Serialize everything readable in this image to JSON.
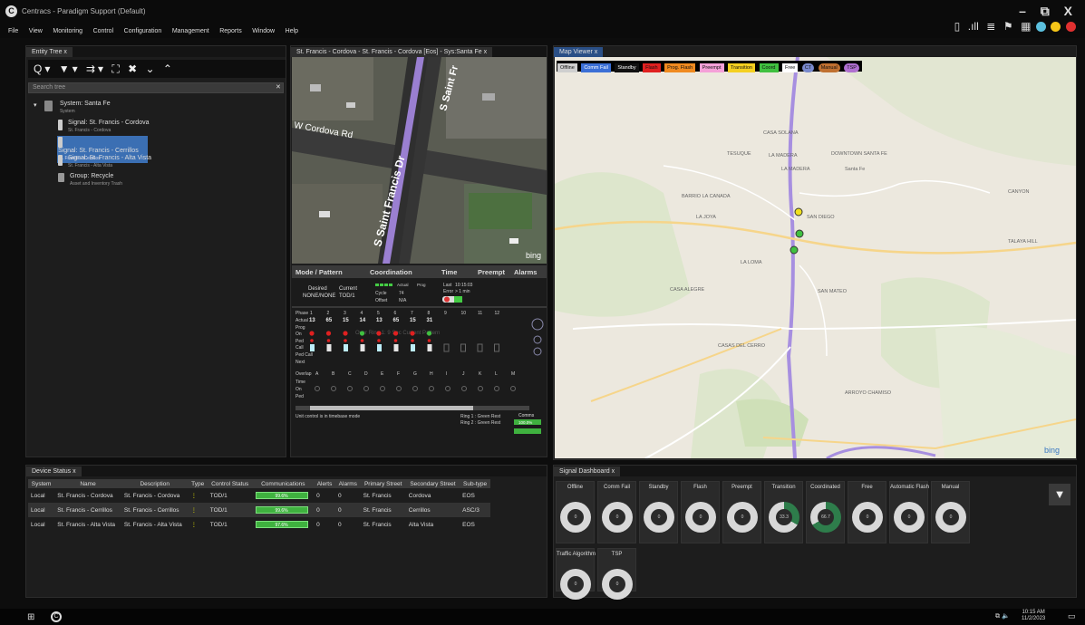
{
  "app": {
    "title": "Centracs - Paradigm Support (Default)",
    "window_controls": "– ⧉ X"
  },
  "menu": [
    "File",
    "View",
    "Monitoring",
    "Control",
    "Configuration",
    "Management",
    "Reports",
    "Window",
    "Help"
  ],
  "status_colors": {
    "teal": "#5bc0de",
    "yellow": "#f5c518",
    "red": "#e03030"
  },
  "entity_tree": {
    "tab": "Entity Tree",
    "close": "x",
    "toolbar": "Q▾ ▼▾ ⇉▾ ⛶ ✖ ⌄ ⌃",
    "search_placeholder": "Search tree",
    "search_clear": "✕",
    "root": {
      "title": "System: Santa Fe",
      "sub": "System"
    },
    "items": [
      {
        "title": "Signal: St. Francis - Cordova",
        "sub": "St. Francis - Cordova",
        "selected": false
      },
      {
        "title": "Signal: St. Francis - Cerrillos",
        "sub": "St. Francis - Cerrillos",
        "selected": true
      },
      {
        "title": "Signal: St. Francis - Alta Vista",
        "sub": "St. Francis - Alta Vista",
        "selected": false
      },
      {
        "title": "Group: Recycle",
        "sub": "Asset and Inventory Trash",
        "selected": false
      }
    ]
  },
  "center": {
    "tab": "St. Francis - Cordova - St. Francis - Cordova [Eos] - Sys:Santa Fe",
    "tab_close": "x",
    "map_labels": {
      "road1": "W Cordova Rd",
      "road2": "S Saint Francis Dr",
      "road3": "S Saint Fr"
    },
    "bing": "bing",
    "headers": [
      "Mode / Pattern",
      "Coordination",
      "Time",
      "Preempt",
      "Alarms"
    ],
    "mode": {
      "desired_label": "Desired",
      "desired_value": "NONE/NONE",
      "current_label": "Current",
      "current_value": "TOD/1"
    },
    "coord": {
      "actual": "Actual",
      "prog": "Prog",
      "cycle_label": "Cycle",
      "cycle_value": "74",
      "offset_label": "Offset",
      "offset_value": "N/A"
    },
    "time": {
      "last_label": "Last",
      "last_value": "10:15:03",
      "error_label": "Error",
      "error_value": "> 1 min"
    },
    "phase_label": "Phase",
    "phases": [
      "1",
      "2",
      "3",
      "4",
      "5",
      "6",
      "7",
      "8",
      "9",
      "10",
      "11",
      "12"
    ],
    "actual_label": "Actual",
    "actual_vals": [
      "13",
      "65",
      "15",
      "14",
      "13",
      "65",
      "15",
      "31"
    ],
    "row_labels": [
      "Prog",
      "On",
      "Ped",
      "Call",
      "Ped Call",
      "Next"
    ],
    "overlap_label": "Overlap",
    "overlaps": [
      "A",
      "B",
      "C",
      "D",
      "E",
      "F",
      "G",
      "H",
      "I",
      "J",
      "K",
      "L",
      "M"
    ],
    "overlap_rows": [
      "Time",
      "On",
      "Ped"
    ],
    "watermark": "Over Ring 1: 9 Sec Current Pattern",
    "note": "Unit control is in timebase mode",
    "ring1": "Ring 1 : Green Rest",
    "ring2": "Ring 2 : Green Rest",
    "comm": "Comms",
    "comm_pct": "100.0%"
  },
  "map": {
    "tab": "Map Viewer",
    "close": "x",
    "legend": [
      {
        "label": "Offline",
        "color": "#cfcfcf"
      },
      {
        "label": "Comm Fail",
        "color": "#3b6fd6"
      },
      {
        "label": "Standby",
        "color": "#111111"
      },
      {
        "label": "Flash",
        "color": "#e02020"
      },
      {
        "label": "Prog. Flash",
        "color": "#f08a20"
      },
      {
        "label": "Preempt",
        "color": "#f5a0d8"
      },
      {
        "label": "Transition",
        "color": "#f5d020"
      },
      {
        "label": "Coord",
        "color": "#40c040"
      },
      {
        "label": "Free",
        "color": "#ffffff"
      },
      {
        "label": "CT",
        "color": "#7a8acd"
      },
      {
        "label": "Manual",
        "color": "#c07030"
      },
      {
        "label": "TSP",
        "color": "#b070d0"
      }
    ],
    "places": [
      "LA JOYA",
      "SAN MATEO",
      "CASA ALEGRE",
      "CASAS DEL CERRO",
      "SAN DIEGO",
      "LA MADERA",
      "DOWNTOWN SANTA FE",
      "TESUQUE",
      "CANYON",
      "TALAYA HILL",
      "ARROYO CHAMISO",
      "BARRIO LA CANADA",
      "LA LOMA",
      "CASA SOLANA",
      "LA MADERA",
      "Santa Fe"
    ],
    "bing": "bing"
  },
  "device_status": {
    "tab": "Device Status",
    "close": "x",
    "columns": [
      "System",
      "Name",
      "Description",
      "Type",
      "Control Status",
      "Communications",
      "Alerts",
      "Alarms",
      "Primary Street",
      "Secondary Street",
      "Sub-type"
    ],
    "rows": [
      {
        "system": "Local",
        "name": "St. Francis - Cordova",
        "desc": "St. Francis - Cordova",
        "type": "⋮",
        "status": "TOD/1",
        "comm": "99.6%",
        "alerts": "0",
        "alarms": "0",
        "primary": "St. Francis",
        "secondary": "Cordova",
        "subtype": "EOS"
      },
      {
        "system": "Local",
        "name": "St. Francis - Cerrillos",
        "desc": "St. Francis - Cerrillos",
        "type": "⋮",
        "status": "TOD/1",
        "comm": "99.6%",
        "alerts": "0",
        "alarms": "0",
        "primary": "St. Francis",
        "secondary": "Cerrillos",
        "subtype": "ASC/3"
      },
      {
        "system": "Local",
        "name": "St. Francis - Alta Vista",
        "desc": "St. Francis - Alta Vista",
        "type": "⋮",
        "status": "TOD/1",
        "comm": "97.6%",
        "alerts": "0",
        "alarms": "0",
        "primary": "St. Francis",
        "secondary": "Alta Vista",
        "subtype": "EOS"
      }
    ]
  },
  "signal_dashboard": {
    "tab": "Signal Dashboard",
    "close": "x",
    "filter": "▼",
    "gauges": [
      {
        "label": "Offline",
        "value": "0",
        "fill": 0
      },
      {
        "label": "Comm Fail",
        "value": "0",
        "fill": 0
      },
      {
        "label": "Standby",
        "value": "0",
        "fill": 0
      },
      {
        "label": "Flash",
        "value": "0",
        "fill": 0
      },
      {
        "label": "Preempt",
        "value": "0",
        "fill": 0
      },
      {
        "label": "Transition",
        "value": "33.3",
        "fill": 0.333
      },
      {
        "label": "Coordinated",
        "value": "66.7",
        "fill": 0.667
      },
      {
        "label": "Free",
        "value": "0",
        "fill": 0
      },
      {
        "label": "Automatic Flash",
        "value": "0",
        "fill": 0
      },
      {
        "label": "Manual",
        "value": "0",
        "fill": 0
      },
      {
        "label": "Traffic Algorithm",
        "value": "0",
        "fill": 0
      },
      {
        "label": "TSP",
        "value": "0",
        "fill": 0
      }
    ]
  },
  "taskbar": {
    "time": "10:15 AM",
    "date": "11/2/2023"
  }
}
